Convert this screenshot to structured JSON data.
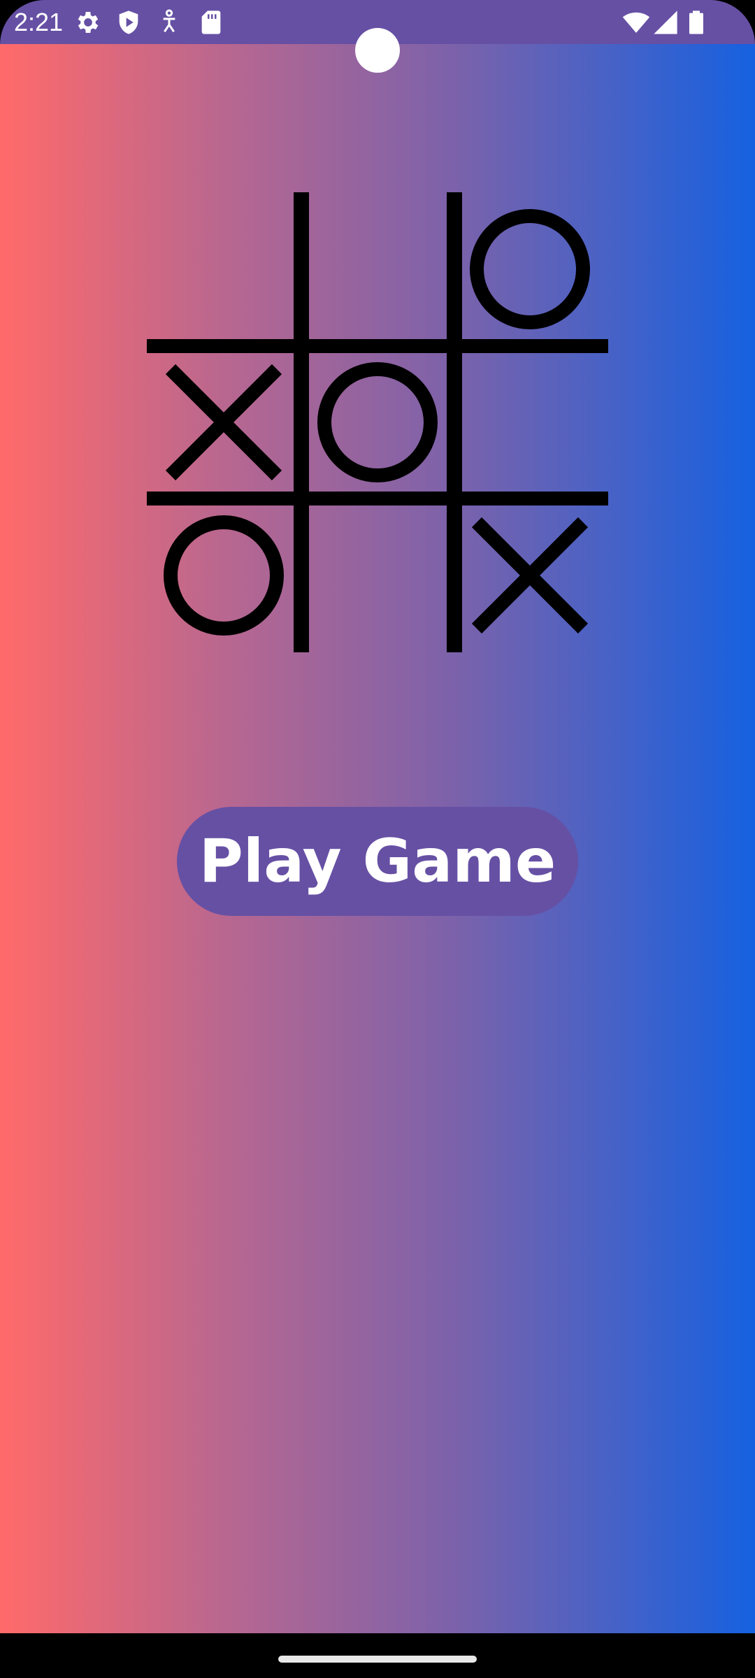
{
  "status_bar": {
    "time": "2:21",
    "background_color": "#6650a4",
    "left_icons": [
      "gear-icon",
      "shield-play-icon",
      "accessibility-icon",
      "sd-card-icon"
    ],
    "right_icons": [
      "wifi-icon",
      "cellular-signal-icon",
      "battery-icon"
    ]
  },
  "background": {
    "gradient": [
      "#ff6a6a",
      "#b86790",
      "#7c62aa",
      "#1661e0"
    ]
  },
  "board": {
    "cells": [
      [
        "",
        "",
        "O"
      ],
      [
        "X",
        "O",
        ""
      ],
      [
        "O",
        "",
        "X"
      ]
    ],
    "mark_color": "#000000"
  },
  "play_button": {
    "label": "Play Game",
    "background_color": "#6650a4",
    "text_color": "#ffffff"
  }
}
